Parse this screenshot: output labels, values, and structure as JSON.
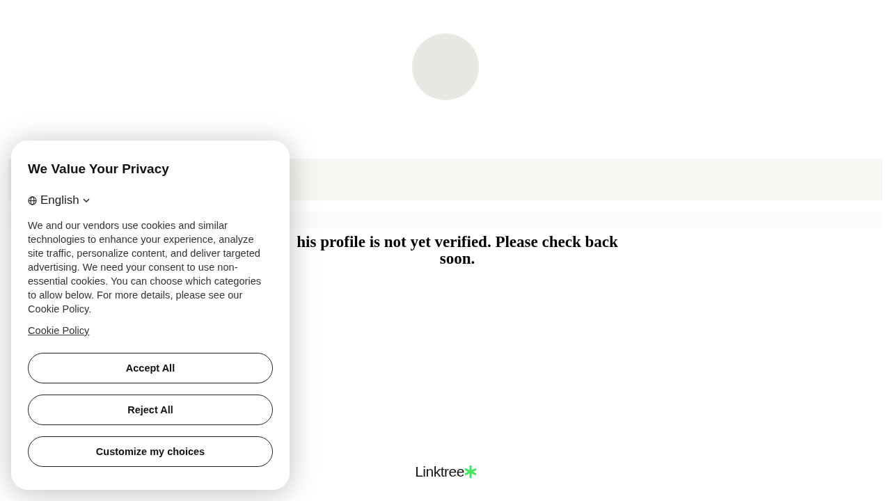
{
  "profile": {
    "message": "his profile is not yet verified. Please check back soon."
  },
  "footer": {
    "logo": "Linktree"
  },
  "cookie_dialog": {
    "title": "We Value Your Privacy",
    "language": "English",
    "body": "We and our vendors use cookies and similar technologies to enhance your experience, analyze site traffic, personalize content, and deliver targeted advertising. We need your consent to use non-essential cookies. You can choose which categories to allow below. For more details, please see our Cookie Policy.",
    "link": "Cookie Policy",
    "buttons": [
      "Accept All",
      "Reject All",
      "Customize my choices"
    ]
  }
}
